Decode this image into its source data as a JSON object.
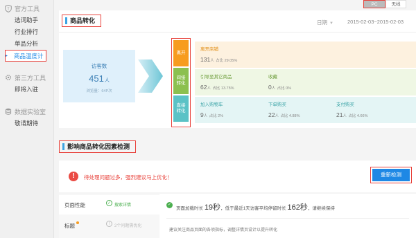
{
  "sidebar": {
    "groups": [
      {
        "label": "官方工具",
        "icon": "shield-icon",
        "items": [
          "选词助手",
          "行业排行",
          "单品分析",
          "商品温度计"
        ]
      },
      {
        "label": "第三方工具",
        "icon": "gear-icon",
        "items": [
          "即将入驻"
        ]
      },
      {
        "label": "数据实验室",
        "icon": "database-icon",
        "items": [
          "敬请期待"
        ]
      }
    ]
  },
  "toggle": {
    "pc": "PC",
    "wireless": "无线"
  },
  "conversion": {
    "title": "商品转化",
    "date_label": "日期",
    "date_range": "2015-02-03~2015-02-03",
    "visitors": {
      "label": "访客数",
      "value": "451",
      "unit": "人",
      "pageviews": "浏览量：64P次"
    },
    "funnel": [
      {
        "label": "离开",
        "color": "#f79c1f"
      },
      {
        "label": "间接\n转化",
        "color": "#8cc04f"
      },
      {
        "label": "直接\n转化",
        "color": "#5bc2c6"
      }
    ],
    "leave": {
      "title": "离开店铺",
      "value": "131",
      "unit": "人",
      "pct": "占比 29.05%"
    },
    "indirect": [
      {
        "title": "引导至其它商品",
        "value": "62",
        "unit": "人",
        "pct": "占比 13.75%"
      },
      {
        "title": "收藏",
        "value": "0",
        "unit": "人",
        "pct": "占比 0%"
      }
    ],
    "direct": [
      {
        "title": "加入购物车",
        "value": "9",
        "unit": "人",
        "pct": "占比 2%"
      },
      {
        "title": "下单购买",
        "value": "22",
        "unit": "人",
        "pct": "占比 4.88%"
      },
      {
        "title": "支付购买",
        "value": "21",
        "unit": "人",
        "pct": "占比 4.66%"
      }
    ]
  },
  "factors": {
    "title": "影响商品转化因素检测",
    "alert": "待处理问题过多，强烈建议马上优化！",
    "recheck_button": "重新检测",
    "tabs": [
      {
        "name": "页面性能",
        "status": "搜索详情",
        "ok": true
      },
      {
        "name": "标题",
        "status": "2个问题需优化",
        "ok": false
      }
    ],
    "detail": {
      "prefix": "页面加载时长",
      "load_time": "19秒",
      "mid": "，低于最近1天访客平均停留时长",
      "stay_time": "162秒",
      "suffix": "，请继续保持",
      "advice": "建议关注商品页面的各项指标，调整详情页设计以提升转化"
    }
  }
}
